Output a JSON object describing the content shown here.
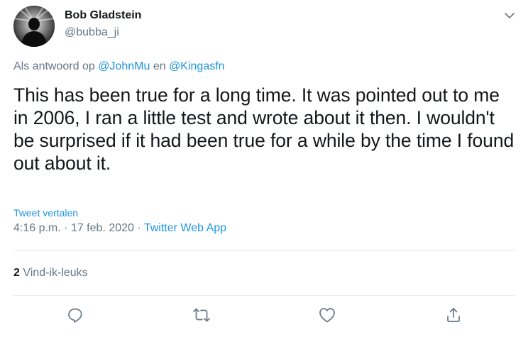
{
  "author": {
    "display_name": "Bob Gladstein",
    "handle": "@bubba_ji"
  },
  "header": {
    "caret_icon": "chevron-down-icon"
  },
  "reply_context": {
    "prefix": "Als antwoord op",
    "mention_1": "@JohnMu",
    "joiner": "en",
    "mention_2": "@Kingasfn"
  },
  "tweet": {
    "text": "This has been true for a long time. It was pointed out to me in 2006, I ran a little test and wrote about it then. I wouldn't be surprised if it had been true for a while by the time I found out about it.",
    "translate_label": "Tweet vertalen",
    "time": "4:16 p.m.",
    "separator": "·",
    "date": "17 feb. 2020",
    "source": "Twitter Web App"
  },
  "stats": {
    "likes_count": "2",
    "likes_label": "Vind-ik-leuks"
  },
  "actions": {
    "reply_icon": "reply-icon",
    "retweet_icon": "retweet-icon",
    "like_icon": "heart-icon",
    "share_icon": "share-icon"
  },
  "colors": {
    "link": "#1b95e0",
    "secondary_text": "#657786",
    "primary_text": "#14171a",
    "divider": "#e6ecf0"
  }
}
